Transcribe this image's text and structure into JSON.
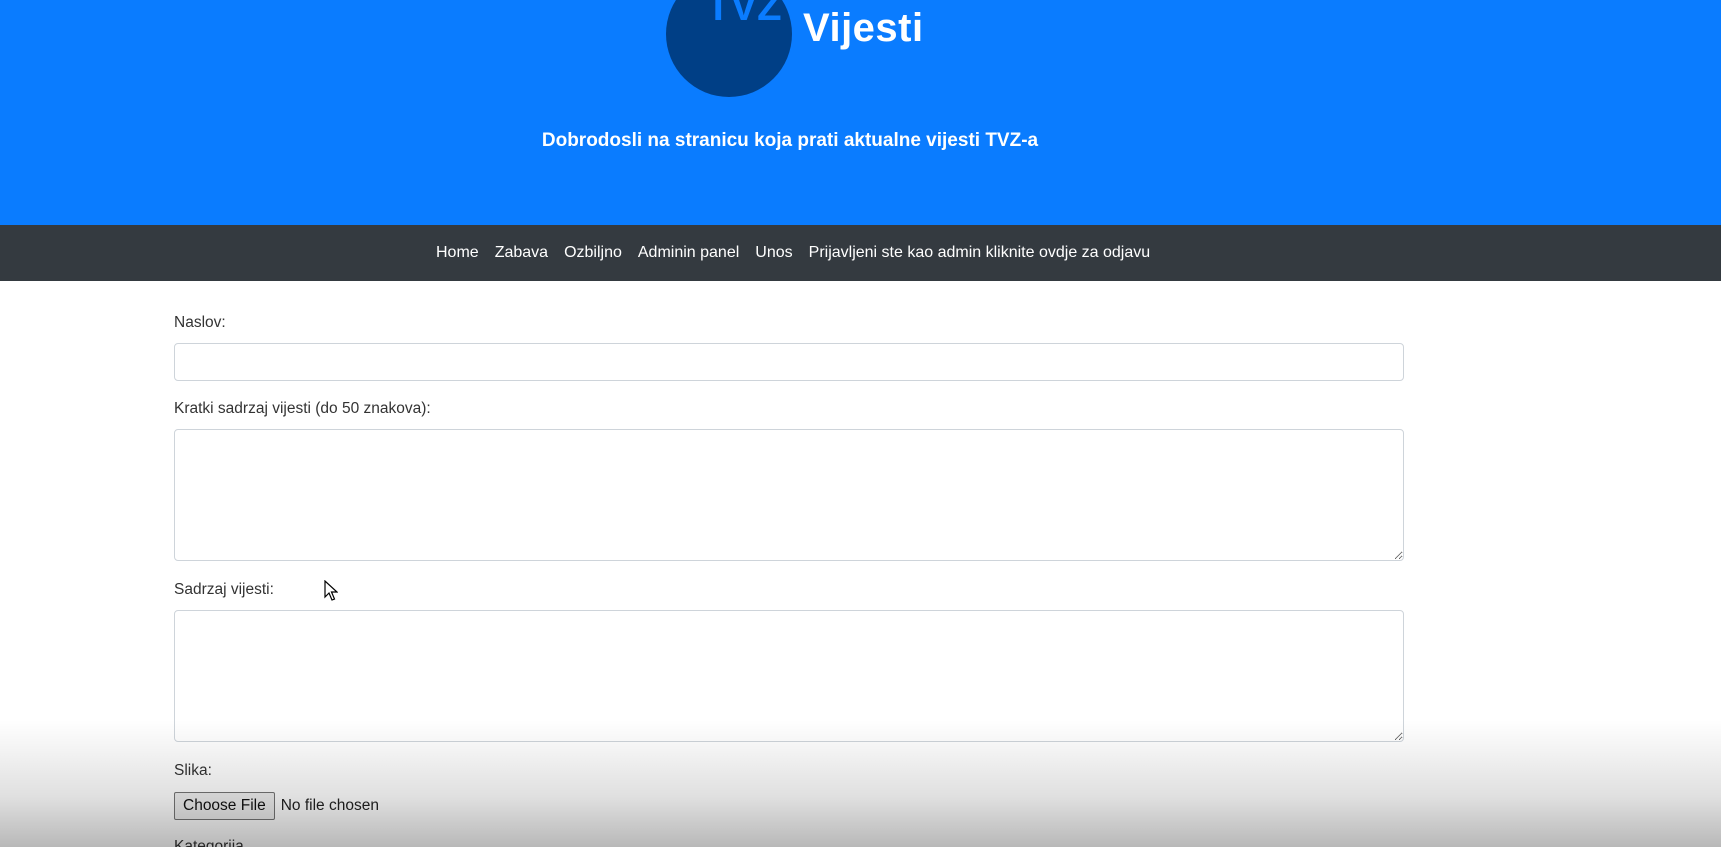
{
  "header": {
    "logo_text": "TVZ",
    "site_title": "Vijesti",
    "welcome": "Dobrodosli na stranicu koja prati aktualne vijesti TVZ-a",
    "background_color": "#0a7cff",
    "logo_color": "#003f86"
  },
  "nav": {
    "items": [
      {
        "label": "Home"
      },
      {
        "label": "Zabava"
      },
      {
        "label": "Ozbiljno"
      },
      {
        "label": "Adminin panel"
      },
      {
        "label": "Unos"
      },
      {
        "label": "Prijavljeni ste kao admin kliknite ovdje za odjavu"
      }
    ],
    "background_color": "#343a40"
  },
  "form": {
    "title_label": "Naslov:",
    "title_value": "",
    "summary_label": "Kratki sadrzaj vijesti (do 50 znakova):",
    "summary_value": "",
    "content_label": "Sadrzaj vijesti:",
    "content_value": "",
    "image_label": "Slika:",
    "file_button_label": "Choose File",
    "file_status": "No file chosen",
    "category_label": "Kategorija"
  }
}
